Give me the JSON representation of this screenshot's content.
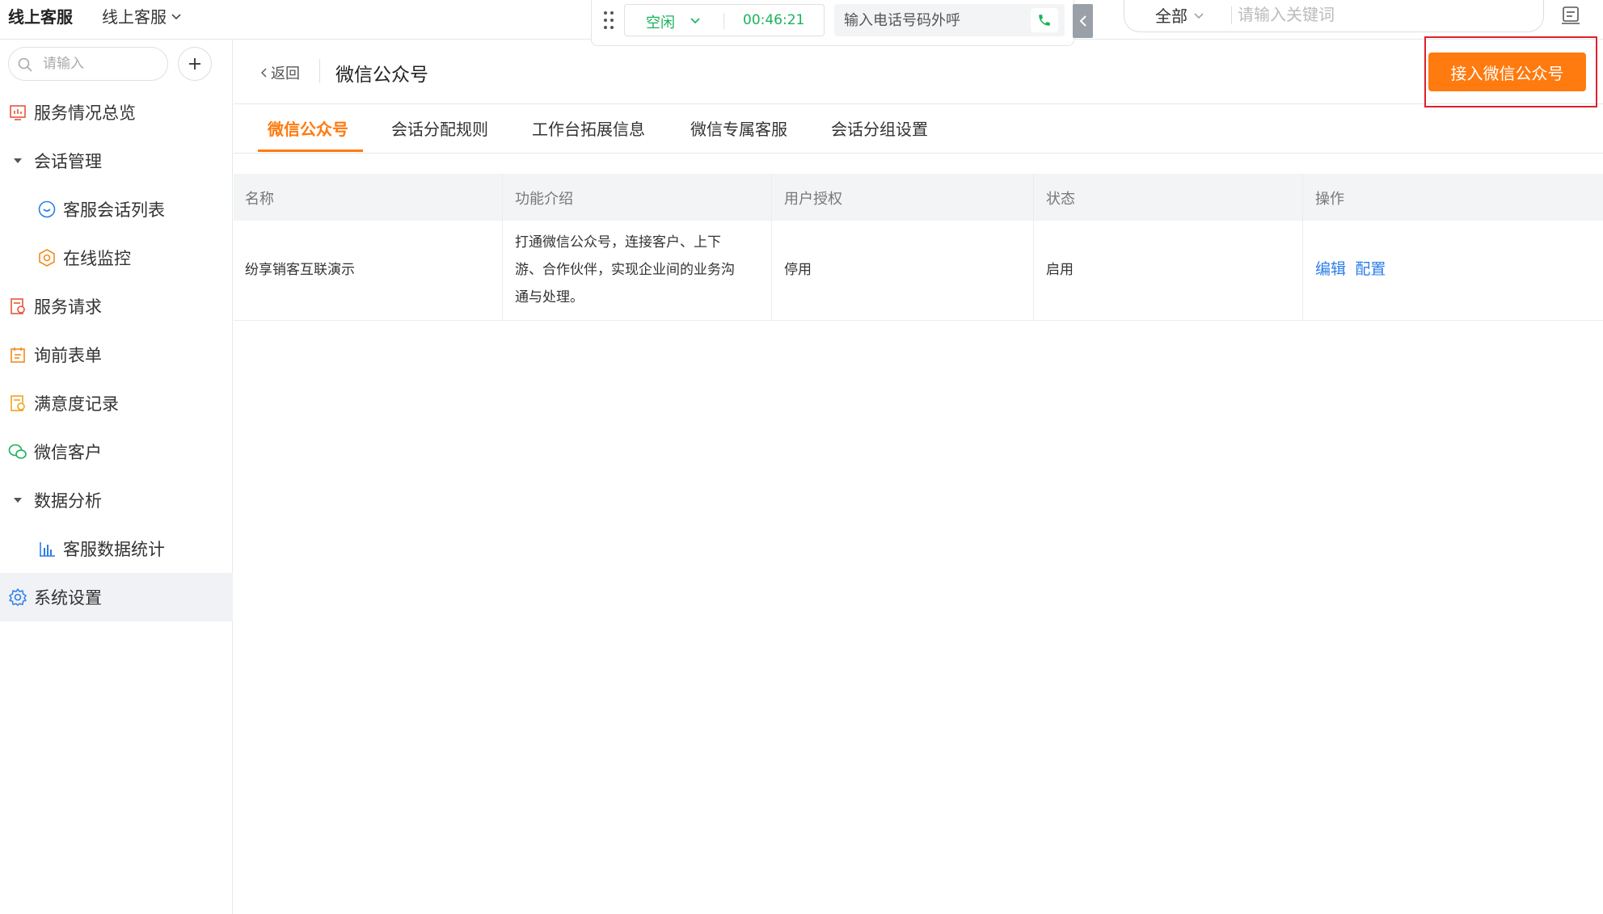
{
  "topbar": {
    "brand": "线上客服",
    "brand_switch": "线上客服",
    "status": "空闲",
    "timer": "00:46:21",
    "phone_placeholder": "输入电话号码外呼",
    "scope": "全部",
    "keyword_placeholder": "请输入关键词"
  },
  "sidebar": {
    "search_placeholder": "请输入",
    "items": [
      {
        "label": "服务情况总览"
      },
      {
        "label": "会话管理"
      },
      {
        "label": "客服会话列表"
      },
      {
        "label": "在线监控"
      },
      {
        "label": "服务请求"
      },
      {
        "label": "询前表单"
      },
      {
        "label": "满意度记录"
      },
      {
        "label": "微信客户"
      },
      {
        "label": "数据分析"
      },
      {
        "label": "客服数据统计"
      },
      {
        "label": "系统设置"
      }
    ]
  },
  "page": {
    "back": "返回",
    "title": "微信公众号",
    "primary_button": "接入微信公众号"
  },
  "tabs": [
    "微信公众号",
    "会话分配规则",
    "工作台拓展信息",
    "微信专属客服",
    "会话分组设置"
  ],
  "table": {
    "columns": [
      "名称",
      "功能介绍",
      "用户授权",
      "状态",
      "操作"
    ],
    "rows": [
      {
        "name": "纷享销客互联演示",
        "desc_lines": [
          "打通微信公众号，连接客户、上下",
          "游、合作伙伴，实现企业间的业务沟",
          "通与处理。"
        ],
        "auth": "停用",
        "status": "启用",
        "actions": [
          "编辑",
          "配置"
        ]
      }
    ]
  },
  "colors": {
    "accent": "#ff7a0f",
    "link": "#2b7de9",
    "status_green": "#19b35a",
    "highlight": "#e0202a"
  }
}
